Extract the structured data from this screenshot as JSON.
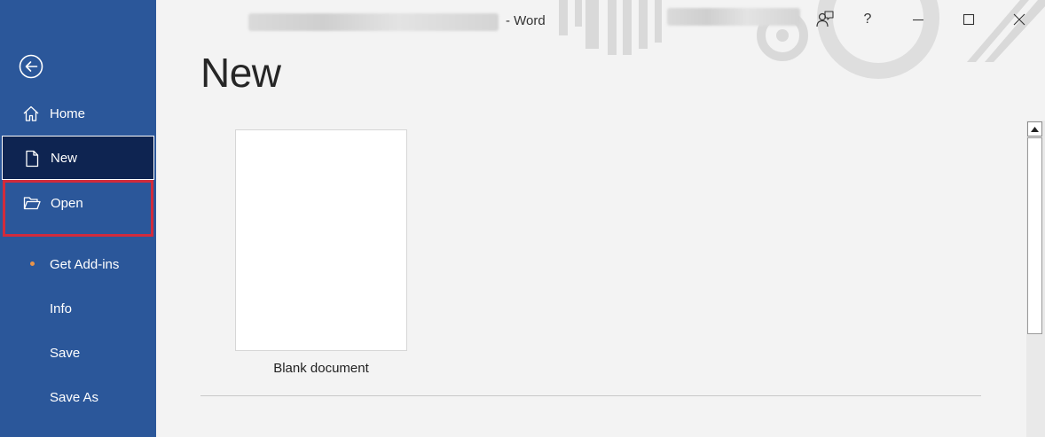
{
  "titlebar": {
    "app_suffix": "-  Word",
    "document_name_redacted": true,
    "account_name_redacted": true
  },
  "window_controls": {
    "coauthor_icon": "person-chat-icon",
    "help_label": "?",
    "minimize_icon": "minimize-icon",
    "maximize_icon": "maximize-icon",
    "close_icon": "close-icon"
  },
  "sidebar": {
    "background": "#2b579a",
    "selected_background": "#0e2451",
    "highlight_border": "#d12b3c",
    "items": [
      {
        "label": "Home",
        "icon": "home-icon"
      },
      {
        "label": "New",
        "icon": "document-icon",
        "selected": true
      },
      {
        "label": "Open",
        "icon": "folder-open-icon",
        "highlighted": true
      },
      {
        "label": "Get Add-ins",
        "icon": "dot-indicator"
      },
      {
        "label": "Info"
      },
      {
        "label": "Save"
      },
      {
        "label": "Save As"
      }
    ]
  },
  "main": {
    "title": "New",
    "templates": [
      {
        "label": "Blank document"
      }
    ]
  }
}
